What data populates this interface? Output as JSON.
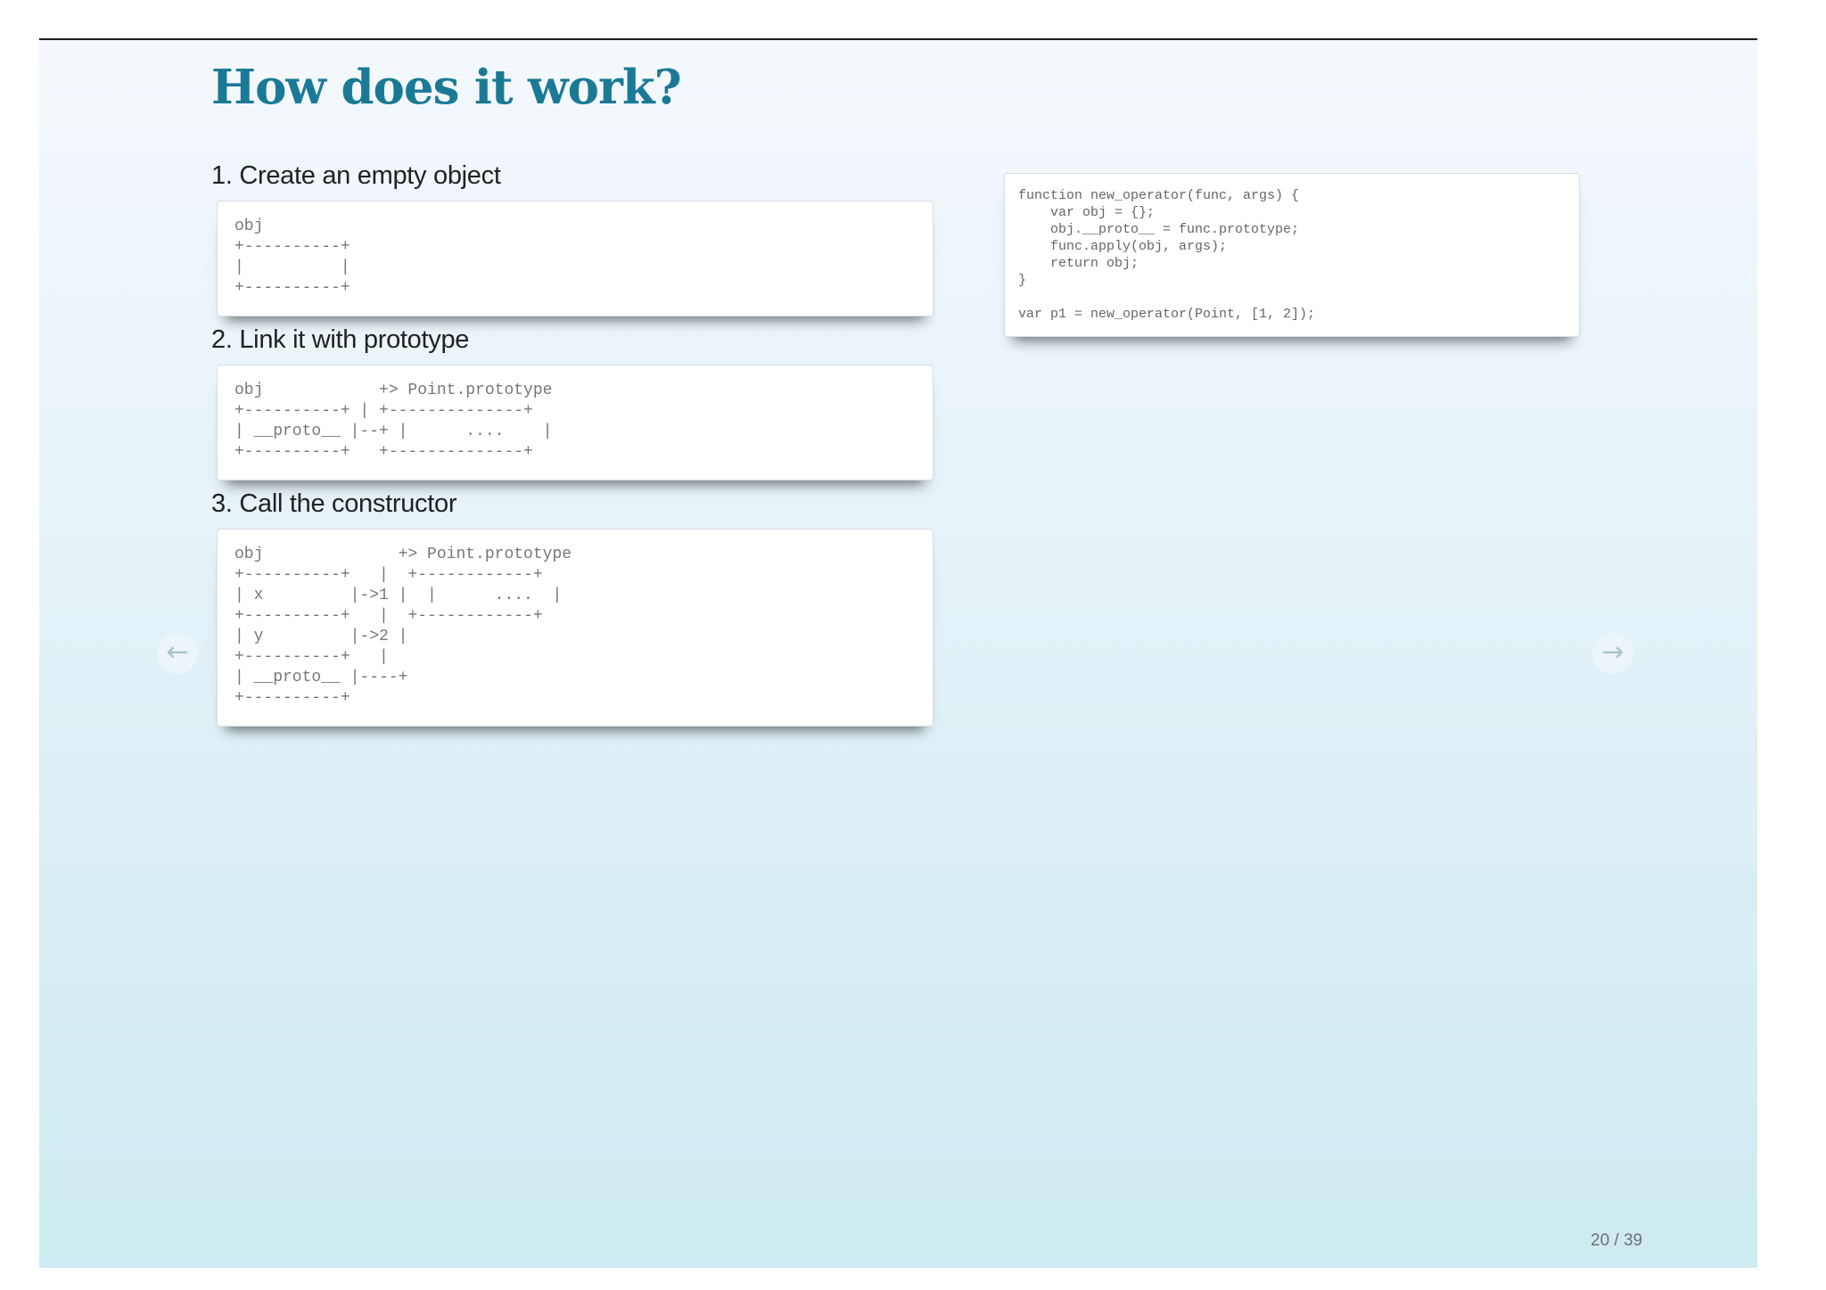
{
  "slide": {
    "title": "How does it work?",
    "steps": [
      {
        "label": "1. Create an empty object",
        "diagram": "obj\n+----------+\n|          |\n+----------+"
      },
      {
        "label": "2. Link it with prototype",
        "diagram": "obj            +> Point.prototype\n+----------+ | +--------------+\n| __proto__ |--+ |      ....    |\n+----------+   +--------------+"
      },
      {
        "label": "3. Call the constructor",
        "diagram": "obj              +> Point.prototype\n+----------+   |  +------------+\n| x         |->1 |  |      ....  |\n+----------+   |  +------------+\n| y         |->2 |\n+----------+   |\n| __proto__ |----+\n+----------+"
      }
    ],
    "code": "function new_operator(func, args) {\n    var obj = {};\n    obj.__proto__ = func.prototype;\n    func.apply(obj, args);\n    return obj;\n}\n\nvar p1 = new_operator(Point, [1, 2]);",
    "nav": {
      "prev_icon": "←",
      "next_icon": "→"
    },
    "page_number": "20 / 39"
  }
}
